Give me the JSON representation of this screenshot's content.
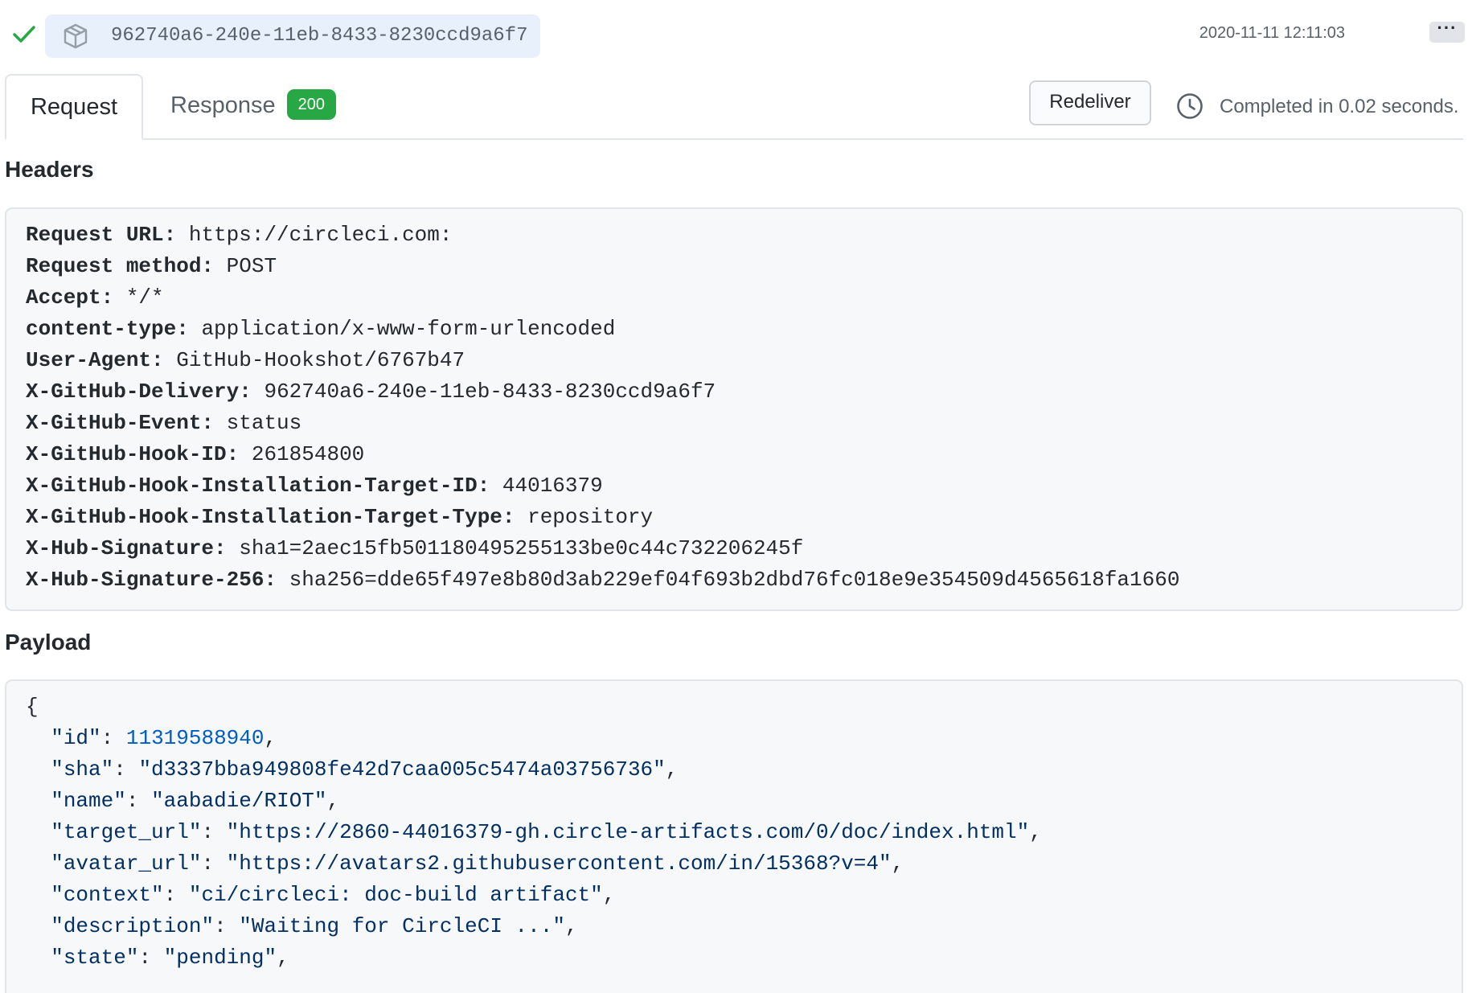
{
  "delivery": {
    "guid": "962740a6-240e-11eb-8433-8230ccd9a6f7",
    "timestamp": "2020-11-11 12:11:03",
    "more_label": "···"
  },
  "tabs": {
    "request_label": "Request",
    "response_label": "Response",
    "response_status": "200"
  },
  "actions": {
    "redeliver_label": "Redeliver",
    "completed_text": "Completed in 0.02 seconds."
  },
  "headers": {
    "title": "Headers",
    "items": [
      {
        "key": "Request URL:",
        "value": " https://circleci.com:"
      },
      {
        "key": "Request method:",
        "value": " POST"
      },
      {
        "key": "Accept:",
        "value": " */*"
      },
      {
        "key": "content-type:",
        "value": " application/x-www-form-urlencoded"
      },
      {
        "key": "User-Agent:",
        "value": " GitHub-Hookshot/6767b47"
      },
      {
        "key": "X-GitHub-Delivery:",
        "value": " 962740a6-240e-11eb-8433-8230ccd9a6f7"
      },
      {
        "key": "X-GitHub-Event:",
        "value": " status"
      },
      {
        "key": "X-GitHub-Hook-ID:",
        "value": " 261854800"
      },
      {
        "key": "X-GitHub-Hook-Installation-Target-ID:",
        "value": " 44016379"
      },
      {
        "key": "X-GitHub-Hook-Installation-Target-Type:",
        "value": " repository"
      },
      {
        "key": "X-Hub-Signature:",
        "value": " sha1=2aec15fb501180495255133be0c44c732206245f"
      },
      {
        "key": "X-Hub-Signature-256:",
        "value": " sha256=dde65f497e8b80d3ab229ef04f693b2dbd76fc018e9e354509d4565618fa1660"
      }
    ]
  },
  "payload": {
    "title": "Payload",
    "open_brace": "{",
    "fields": [
      {
        "key": "\"id\"",
        "value": "11319588940",
        "type": "number"
      },
      {
        "key": "\"sha\"",
        "value": "\"d3337bba949808fe42d7caa005c5474a03756736\"",
        "type": "string"
      },
      {
        "key": "\"name\"",
        "value": "\"aabadie/RIOT\"",
        "type": "string"
      },
      {
        "key": "\"target_url\"",
        "value": "\"https://2860-44016379-gh.circle-artifacts.com/0/doc/index.html\"",
        "type": "string"
      },
      {
        "key": "\"avatar_url\"",
        "value": "\"https://avatars2.githubusercontent.com/in/15368?v=4\"",
        "type": "string"
      },
      {
        "key": "\"context\"",
        "value": "\"ci/circleci: doc-build artifact\"",
        "type": "string"
      },
      {
        "key": "\"description\"",
        "value": "\"Waiting for CircleCI ...\"",
        "type": "string"
      },
      {
        "key": "\"state\"",
        "value": "\"pending\"",
        "type": "string"
      }
    ]
  },
  "colors": {
    "success": "#28a745",
    "guid_background": "#e8f1fb",
    "code_background": "#f6f8fa",
    "json_number": "#005cc5",
    "json_string": "#032f62"
  },
  "icons": {
    "status": "check-icon",
    "delivery": "package-icon",
    "duration": "clock-icon"
  }
}
